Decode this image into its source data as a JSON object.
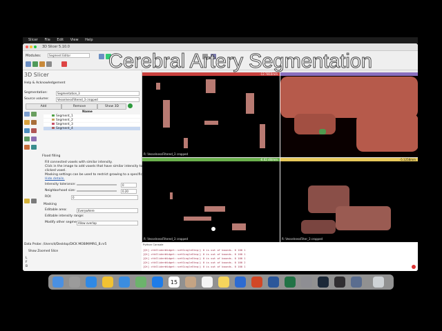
{
  "overlay_title": "Cerebral Artery Segmentation",
  "menubar": {
    "items": [
      "Slicer",
      "File",
      "Edit",
      "View",
      "Help"
    ]
  },
  "window": {
    "title": "3D Slicer 5.10.0",
    "modules_label": "Modules:",
    "module_name": "Segment Editor"
  },
  "left_panel": {
    "logo_text": "3D Slicer",
    "help_section": "Help & Acknowledgement",
    "segmentation_label": "Segmentation:",
    "segmentation_value": "Segmentation_3",
    "source_label": "Source volume:",
    "source_value": "VesselnessFiltered_3 cropped",
    "add_button": "Add",
    "remove_button": "Remove",
    "show3d_button": "Show 3D",
    "segments_header": "Name",
    "segments": [
      {
        "name": "Segment_1",
        "color": "#52a34a"
      },
      {
        "name": "Segment_2",
        "color": "#c7a15a"
      },
      {
        "name": "Segment_3",
        "color": "#c94f6a"
      },
      {
        "name": "Segment_4",
        "color": "#b06060"
      }
    ],
    "effect_title": "Flood filling",
    "effect_desc": [
      "Fill connected voxels with similar intensity.",
      "Click in the image to add voxels that have similar intensity to the",
      "clicked voxel.",
      "Masking settings can be used to restrict growing to a specific region."
    ],
    "hide_details": "Hide details.",
    "intensity_tolerance_label": "Intensity tolerance:",
    "intensity_tolerance_value": "0",
    "neighborhood_label": "Neighborhood size:",
    "neighborhood_value": "0.20",
    "roi_label": "ROI:",
    "roi_value": "0",
    "masking_section": "Masking",
    "editable_area_label": "Editable area:",
    "editable_area_value": "Everywhere",
    "editable_intensity_label": "Editable intensity range:",
    "modify_other_label": "Modify other segments:",
    "modify_other_value": "Allow overlap",
    "data_probe_label": "Data Probe: /Users/d/Desktop/DICK MOBIM/MRG_B.nr5",
    "show_zoomed_label": "Show Zoomed Slice",
    "probe_rows": [
      "L",
      "F",
      "B"
    ]
  },
  "views": {
    "top_left": {
      "label": "R: VesselnessFiltered_3 cropped",
      "bar_color": "#c9413e",
      "value": "-12.7810mm"
    },
    "top_right": {
      "label": "",
      "bar_color": "#8a6fbf",
      "value": ""
    },
    "bottom_left": {
      "label": "R: VesselnessFiltered_3 cropped",
      "bar_color": "#6ab04c",
      "value": "-6.02 dll/mm"
    },
    "bottom_right": {
      "label": "R: VesselnessFilter_3 cropped",
      "bar_color": "#e7c85a",
      "value": "-5.1258mm"
    }
  },
  "console": {
    "title": "Python Console",
    "lines": [
      "[Qt] ctkSliderWidget::setSingleStep()  0 is out of bounds. 0 100 1",
      "[Qt] ctkSliderWidget::setSingleStep()  0 is out of bounds. 0 100 1",
      "[Qt] ctkSliderWidget::setSingleStep()  0 is out of bounds. 0 100 1",
      "[Qt] ctkSliderWidget::setSingleStep()  0 is out of bounds. 0 100 2",
      "[Qt] ctkSliderWidget::setSingleStep()  0 is out of bounds. 0 100 1"
    ]
  },
  "dock_icons": [
    "finder",
    "launchpad",
    "safari",
    "photos",
    "mail",
    "maps",
    "app-store",
    "calendar",
    "contacts",
    "reminders",
    "notes",
    "keynote",
    "powerpoint",
    "word",
    "excel",
    "system-settings",
    "steam",
    "obs",
    "3d-slicer",
    "trash"
  ],
  "dock_calendar_day": "15"
}
